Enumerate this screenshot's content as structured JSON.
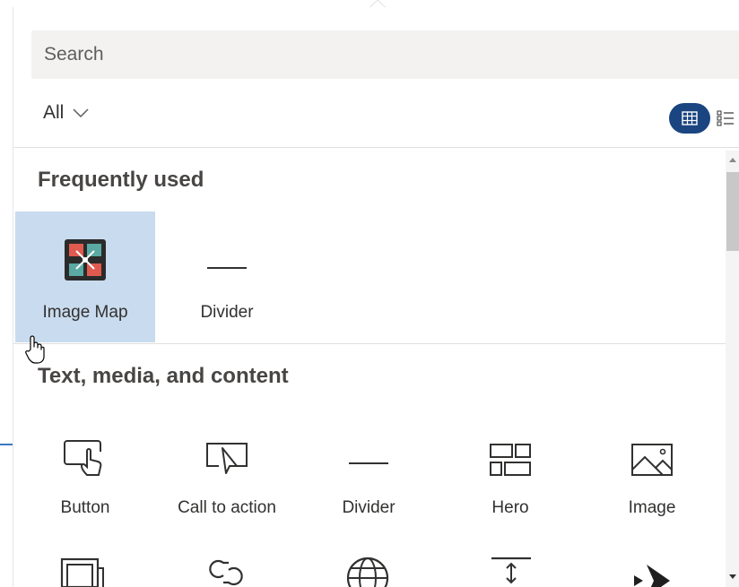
{
  "search": {
    "placeholder": "Search"
  },
  "filter": {
    "label": "All"
  },
  "sections": {
    "frequent": {
      "title": "Frequently used",
      "items": [
        {
          "label": "Image Map",
          "icon": "image-map-icon",
          "selected": true
        },
        {
          "label": "Divider",
          "icon": "divider-icon"
        }
      ]
    },
    "text_media": {
      "title": "Text, media, and content",
      "items": [
        {
          "label": "Button",
          "icon": "button-icon"
        },
        {
          "label": "Call to action",
          "icon": "call-to-action-icon"
        },
        {
          "label": "Divider",
          "icon": "divider-icon"
        },
        {
          "label": "Hero",
          "icon": "hero-icon"
        },
        {
          "label": "Image",
          "icon": "image-icon"
        }
      ]
    }
  },
  "colors": {
    "accent": "#1b4580",
    "selected_bg": "#c9dbee",
    "search_bg": "#f3f2f1"
  }
}
